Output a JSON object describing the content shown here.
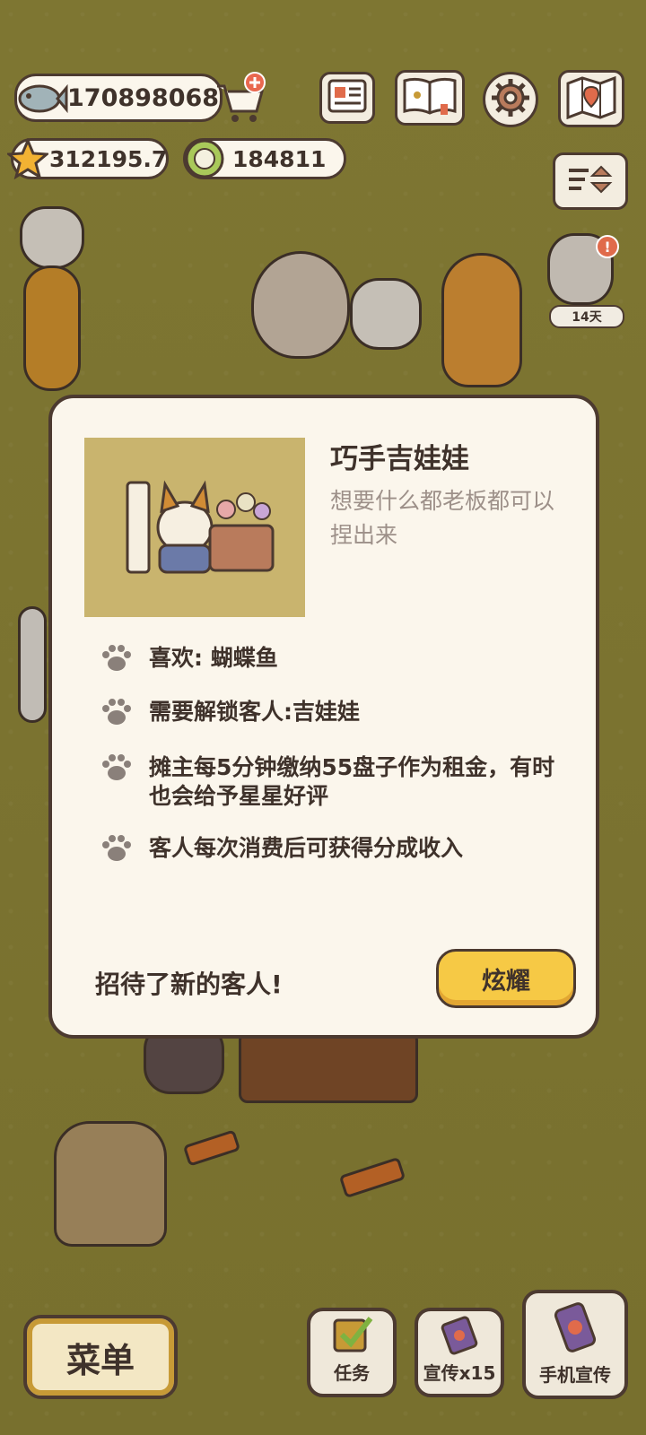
{
  "resources": {
    "fish": "170898068",
    "stars": "312195.7",
    "coins": "184811"
  },
  "toolbar": {
    "icons": [
      "newspaper-icon",
      "book-icon",
      "gear-icon",
      "map-icon",
      "sort-icon"
    ]
  },
  "event": {
    "days_badge": "14天"
  },
  "modal": {
    "title": "巧手吉娃娃",
    "description": "想要什么都老板都可以捏出来",
    "features": [
      "喜欢: 蝴蝶鱼",
      "需要解锁客人:吉娃娃",
      "摊主每5分钟缴纳55盘子作为租金，有时也会给予星星好评",
      "客人每次消费后可获得分成收入"
    ],
    "footer_text": "招待了新的客人!",
    "button_label": "炫耀"
  },
  "bottom_bar": {
    "menu_label": "菜单",
    "task_label": "任务",
    "promo_label": "宣传x15",
    "phone_promo_label": "手机宣传"
  },
  "colors": {
    "background": "#8a8236",
    "panel": "#fbf6ec",
    "outline": "#4c3a30",
    "button_yellow": "#f6c945",
    "thumbnail_bg": "#c9b46e"
  }
}
